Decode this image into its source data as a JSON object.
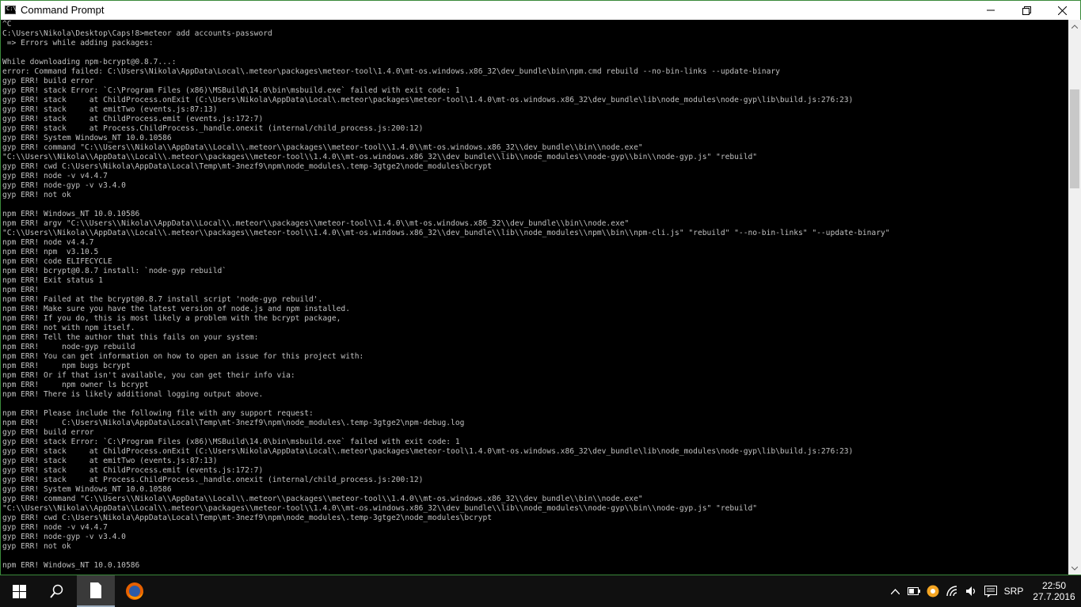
{
  "window": {
    "title": "Command Prompt"
  },
  "console": {
    "lines": [
      "^C",
      "C:\\Users\\Nikola\\Desktop\\Caps!8>meteor add accounts-password",
      " => Errors while adding packages:",
      "",
      "While downloading npm-bcrypt@0.8.7...:",
      "error: Command failed: C:\\Users\\Nikola\\AppData\\Local\\.meteor\\packages\\meteor-tool\\1.4.0\\mt-os.windows.x86_32\\dev_bundle\\bin\\npm.cmd rebuild --no-bin-links --update-binary",
      "gyp ERR! build error",
      "gyp ERR! stack Error: `C:\\Program Files (x86)\\MSBuild\\14.0\\bin\\msbuild.exe` failed with exit code: 1",
      "gyp ERR! stack     at ChildProcess.onExit (C:\\Users\\Nikola\\AppData\\Local\\.meteor\\packages\\meteor-tool\\1.4.0\\mt-os.windows.x86_32\\dev_bundle\\lib\\node_modules\\node-gyp\\lib\\build.js:276:23)",
      "gyp ERR! stack     at emitTwo (events.js:87:13)",
      "gyp ERR! stack     at ChildProcess.emit (events.js:172:7)",
      "gyp ERR! stack     at Process.ChildProcess._handle.onexit (internal/child_process.js:200:12)",
      "gyp ERR! System Windows_NT 10.0.10586",
      "gyp ERR! command \"C:\\\\Users\\\\Nikola\\\\AppData\\\\Local\\\\.meteor\\\\packages\\\\meteor-tool\\\\1.4.0\\\\mt-os.windows.x86_32\\\\dev_bundle\\\\bin\\\\node.exe\"",
      "\"C:\\\\Users\\\\Nikola\\\\AppData\\\\Local\\\\.meteor\\\\packages\\\\meteor-tool\\\\1.4.0\\\\mt-os.windows.x86_32\\\\dev_bundle\\\\lib\\\\node_modules\\\\node-gyp\\\\bin\\\\node-gyp.js\" \"rebuild\"",
      "gyp ERR! cwd C:\\Users\\Nikola\\AppData\\Local\\Temp\\mt-3nezf9\\npm\\node_modules\\.temp-3gtge2\\node_modules\\bcrypt",
      "gyp ERR! node -v v4.4.7",
      "gyp ERR! node-gyp -v v3.4.0",
      "gyp ERR! not ok",
      "",
      "npm ERR! Windows_NT 10.0.10586",
      "npm ERR! argv \"C:\\\\Users\\\\Nikola\\\\AppData\\\\Local\\\\.meteor\\\\packages\\\\meteor-tool\\\\1.4.0\\\\mt-os.windows.x86_32\\\\dev_bundle\\\\bin\\\\node.exe\"",
      "\"C:\\\\Users\\\\Nikola\\\\AppData\\\\Local\\\\.meteor\\\\packages\\\\meteor-tool\\\\1.4.0\\\\mt-os.windows.x86_32\\\\dev_bundle\\\\lib\\\\node_modules\\\\npm\\\\bin\\\\npm-cli.js\" \"rebuild\" \"--no-bin-links\" \"--update-binary\"",
      "npm ERR! node v4.4.7",
      "npm ERR! npm  v3.10.5",
      "npm ERR! code ELIFECYCLE",
      "npm ERR! bcrypt@0.8.7 install: `node-gyp rebuild`",
      "npm ERR! Exit status 1",
      "npm ERR!",
      "npm ERR! Failed at the bcrypt@0.8.7 install script 'node-gyp rebuild'.",
      "npm ERR! Make sure you have the latest version of node.js and npm installed.",
      "npm ERR! If you do, this is most likely a problem with the bcrypt package,",
      "npm ERR! not with npm itself.",
      "npm ERR! Tell the author that this fails on your system:",
      "npm ERR!     node-gyp rebuild",
      "npm ERR! You can get information on how to open an issue for this project with:",
      "npm ERR!     npm bugs bcrypt",
      "npm ERR! Or if that isn't available, you can get their info via:",
      "npm ERR!     npm owner ls bcrypt",
      "npm ERR! There is likely additional logging output above.",
      "",
      "npm ERR! Please include the following file with any support request:",
      "npm ERR!     C:\\Users\\Nikola\\AppData\\Local\\Temp\\mt-3nezf9\\npm\\node_modules\\.temp-3gtge2\\npm-debug.log",
      "gyp ERR! build error",
      "gyp ERR! stack Error: `C:\\Program Files (x86)\\MSBuild\\14.0\\bin\\msbuild.exe` failed with exit code: 1",
      "gyp ERR! stack     at ChildProcess.onExit (C:\\Users\\Nikola\\AppData\\Local\\.meteor\\packages\\meteor-tool\\1.4.0\\mt-os.windows.x86_32\\dev_bundle\\lib\\node_modules\\node-gyp\\lib\\build.js:276:23)",
      "gyp ERR! stack     at emitTwo (events.js:87:13)",
      "gyp ERR! stack     at ChildProcess.emit (events.js:172:7)",
      "gyp ERR! stack     at Process.ChildProcess._handle.onexit (internal/child_process.js:200:12)",
      "gyp ERR! System Windows_NT 10.0.10586",
      "gyp ERR! command \"C:\\\\Users\\\\Nikola\\\\AppData\\\\Local\\\\.meteor\\\\packages\\\\meteor-tool\\\\1.4.0\\\\mt-os.windows.x86_32\\\\dev_bundle\\\\bin\\\\node.exe\"",
      "\"C:\\\\Users\\\\Nikola\\\\AppData\\\\Local\\\\.meteor\\\\packages\\\\meteor-tool\\\\1.4.0\\\\mt-os.windows.x86_32\\\\dev_bundle\\\\lib\\\\node_modules\\\\node-gyp\\\\bin\\\\node-gyp.js\" \"rebuild\"",
      "gyp ERR! cwd C:\\Users\\Nikola\\AppData\\Local\\Temp\\mt-3nezf9\\npm\\node_modules\\.temp-3gtge2\\node_modules\\bcrypt",
      "gyp ERR! node -v v4.4.7",
      "gyp ERR! node-gyp -v v3.4.0",
      "gyp ERR! not ok",
      "",
      "npm ERR! Windows_NT 10.0.10586"
    ]
  },
  "taskbar": {
    "language": "SRP",
    "time": "22:50",
    "date": "27.7.2016",
    "icons": [
      "windows-start-icon",
      "search-icon",
      "file-explorer-icon",
      "firefox-icon"
    ]
  },
  "tray": {
    "icons": [
      "chevron-up-icon",
      "battery-icon",
      "app-tray-icon",
      "wifi-icon",
      "volume-icon",
      "action-center-icon"
    ]
  },
  "colors": {
    "console_bg": "#000000",
    "console_text": "#c0c0c0",
    "window_border": "#3a8a3a",
    "taskbar_bg": "#101010"
  }
}
